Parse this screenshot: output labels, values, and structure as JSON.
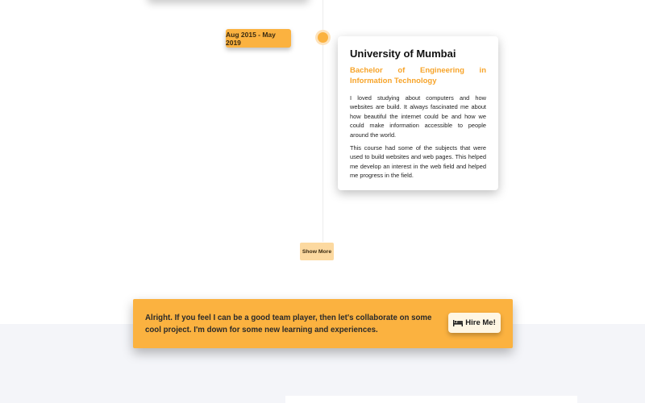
{
  "timeline": {
    "entry": {
      "date": "Aug 2015 - May 2019",
      "institution": "University of Mumbai",
      "degree": "Bachelor of Engineering in Information Technology",
      "paragraphs": [
        "I loved studying about computers and how websites are build. It always fascinated me about how beautiful the internet could be and how we could make information accessible to people around the world.",
        "This course had some of the subjects that were used to build websites and web pages. This helped me develop an interest in the web field and helped me progress in the field."
      ]
    },
    "show_more_label": "Show More"
  },
  "cta": {
    "message": "Alright. If you feel I can be a good team player, then let's collaborate on some cool project. I'm down for some new learning and experiences.",
    "button_label": "Hire Me!",
    "button_icon": "bed-icon"
  },
  "colors": {
    "accent": "#fbb240",
    "accent_text": "#f7a42a",
    "band_bg": "#f4f5f9"
  }
}
